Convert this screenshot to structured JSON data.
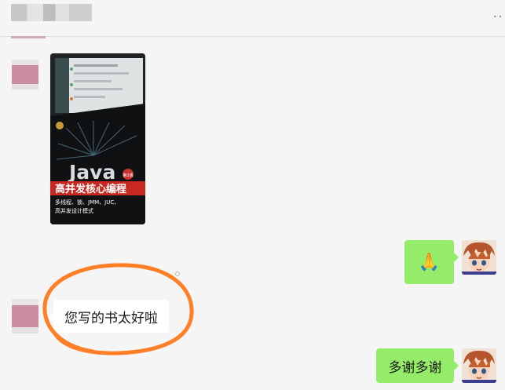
{
  "header": {
    "title": "",
    "more_icon": "more-dots-icon",
    "more_glyph": "··"
  },
  "photo": {
    "cover_brand": "Java",
    "cover_edition": "第2版",
    "cover_title": "高并发核心编程",
    "cover_subtitle_line1": "多线程、锁、JMM、JUC、",
    "cover_subtitle_line2": "高并发设计模式"
  },
  "messages": {
    "sent_1": {
      "text": "🙏",
      "icon": "praying-hands-emoji"
    },
    "received_1": {
      "text": "您写的书太好啦"
    },
    "sent_2": {
      "text": "多谢多谢"
    }
  },
  "annotation": {
    "shape": "hand-drawn-circle",
    "color": "#ff7f27"
  },
  "colors": {
    "sent_bubble": "#95ec69",
    "received_bubble": "#ffffff",
    "background": "#f5f5f5"
  }
}
